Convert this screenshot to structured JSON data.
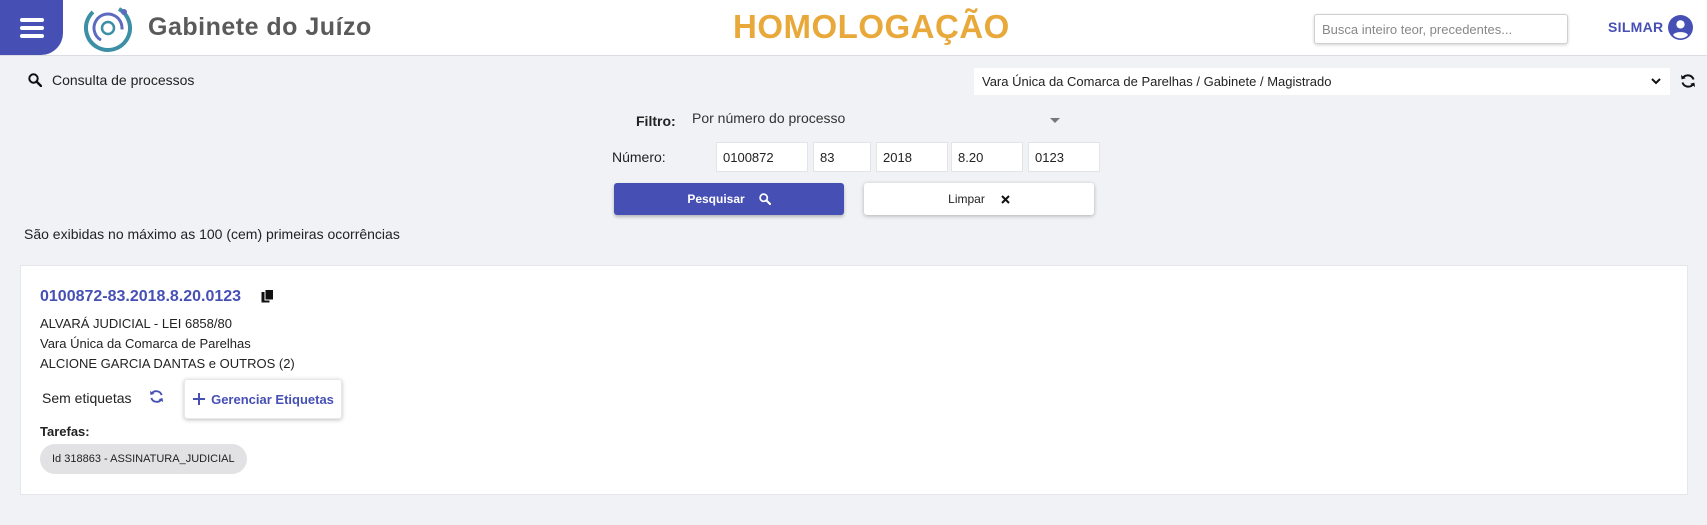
{
  "header": {
    "app_title": "Gabinete do Juízo",
    "environment": "HOMOLOGAÇÃO",
    "search_placeholder": "Busca inteiro teor, precedentes...",
    "user_name": "SILMAR"
  },
  "toolbar": {
    "consulta_label": "Consulta de processos",
    "unit_selected": "Vara Única da Comarca de Parelhas / Gabinete / Magistrado"
  },
  "form": {
    "filtro_label": "Filtro:",
    "filtro_value": "Por número do processo",
    "numero_label": "Número:",
    "numero_parts": [
      "0100872",
      "83",
      "2018",
      "8.20",
      "0123"
    ],
    "pesquisar_label": "Pesquisar",
    "limpar_label": "Limpar"
  },
  "notice": "São exibidas no máximo as 100 (cem) primeiras ocorrências",
  "result": {
    "process_number": "0100872-83.2018.8.20.0123",
    "class": "ALVARÁ JUDICIAL - LEI 6858/80",
    "court": "Vara Única da Comarca de Parelhas",
    "parties": "ALCIONE GARCIA DANTAS e OUTROS (2)",
    "tags_label": "Sem etiquetas",
    "manage_tags_label": "Gerenciar Etiquetas",
    "tasks_label": "Tarefas:",
    "task_chip": "Id 318863 - ASSINATURA_JUDICIAL"
  },
  "colors": {
    "brand": "#4650b4",
    "environment": "#e8a93a",
    "background": "#f0f2f5"
  }
}
